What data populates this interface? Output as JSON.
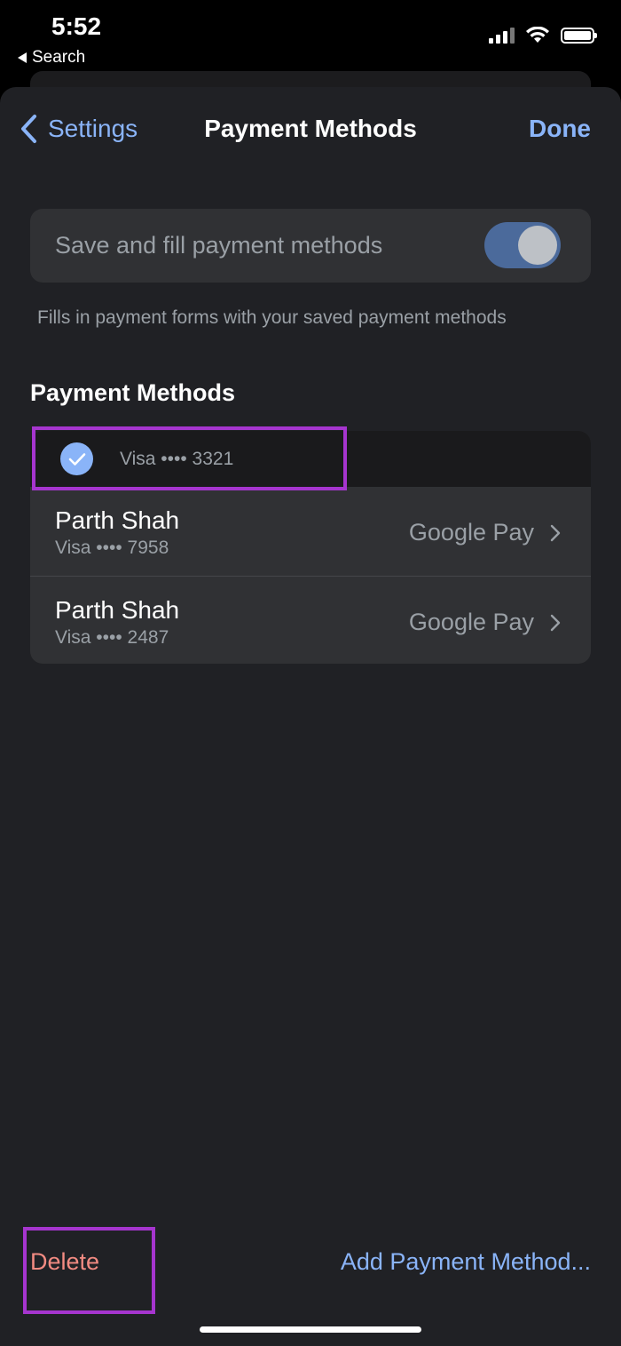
{
  "status_bar": {
    "time": "5:52",
    "back_app_label": "Search"
  },
  "navbar": {
    "back_label": "Settings",
    "title": "Payment Methods",
    "done_label": "Done"
  },
  "toggle": {
    "label": "Save and fill payment methods",
    "enabled": true,
    "footnote": "Fills in payment forms with your saved payment methods"
  },
  "section": {
    "header": "Payment Methods"
  },
  "cards": {
    "selected": {
      "label": "Visa •••• 3321",
      "checked": true
    },
    "items": [
      {
        "name": "Parth Shah",
        "detail": "Visa •••• 7958",
        "source": "Google Pay"
      },
      {
        "name": "Parth Shah",
        "detail": "Visa •••• 2487",
        "source": "Google Pay"
      }
    ]
  },
  "toolbar": {
    "delete_label": "Delete",
    "add_label": "Add Payment Method..."
  },
  "colors": {
    "accent": "#8ab4f8",
    "destructive": "#f28b82",
    "highlight": "#a635cf",
    "background": "#202125"
  }
}
